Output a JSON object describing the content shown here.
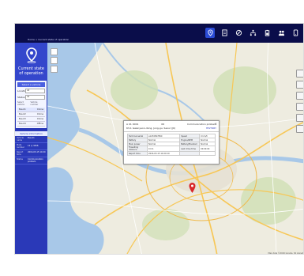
{
  "header": {
    "breadcrumb": "Home > Current state of operation",
    "icons": [
      "location-pin-icon",
      "document-icon",
      "disabled-icon",
      "tree-icon",
      "battery-icon",
      "people-icon",
      "phone-icon"
    ]
  },
  "sidebar": {
    "title_line1": "Current state",
    "title_line2": "of operation",
    "filter_title": "Select a vehicle",
    "filters": [
      {
        "label": "Location",
        "value": "All"
      },
      {
        "label": "Status",
        "value": "All"
      }
    ],
    "subrow_left": "Select vehicle",
    "subrow_right": "Vehicle number",
    "list": [
      {
        "left": "Bus-01",
        "right": "Online",
        "selected": true
      },
      {
        "left": "Bus-02",
        "right": "Online",
        "selected": false
      },
      {
        "left": "Bus-03",
        "right": "Online",
        "selected": false
      },
      {
        "left": "Bus-04",
        "right": "Offline",
        "selected": false
      }
    ],
    "detail_title": "Vehicle information",
    "detail_rows": [
      {
        "k": "Vehicle name",
        "v": "Bus-01"
      },
      {
        "k": "Plate number",
        "v": "12 가 3456"
      },
      {
        "k": "Report time",
        "v": "2016-03-15 10:20"
      },
      {
        "k": "Status",
        "v": "Communication problem"
      }
    ]
  },
  "popup": {
    "id": "A 01 0001",
    "num": "06",
    "status": "Communication problem",
    "address": "63-1 Gwanyeon-dong, Jung-gu, Seoul (J9)",
    "link": "HISTORY",
    "rows": [
      {
        "k1": "Terminal serial",
        "v1": "a1234567890",
        "k2": "Speed",
        "v2": "0 km/h"
      },
      {
        "k1": "Battery",
        "v1": "Normal",
        "k2": "Engine/RPM",
        "v2": "Normal"
      },
      {
        "k1": "Main power",
        "v1": "Normal",
        "k2": "Battery/Boosted",
        "v2": "Normal"
      },
      {
        "k1": "Travelling distance",
        "v1": "0 km",
        "k2": "Last drive time",
        "v2": "00:00:00"
      },
      {
        "k1": "Report time",
        "v1": "2016-03-15 10:20:19",
        "k2": "",
        "v2": ""
      }
    ]
  },
  "map": {
    "copyright": "Map data ©2016 Google, SK planet"
  },
  "colors": {
    "topbar": "#0a0d4a",
    "sidebar": "#2a39b8",
    "accent": "#2b4cd6",
    "water": "#a8c8e8",
    "land": "#eeece0",
    "road": "#f7c756"
  }
}
